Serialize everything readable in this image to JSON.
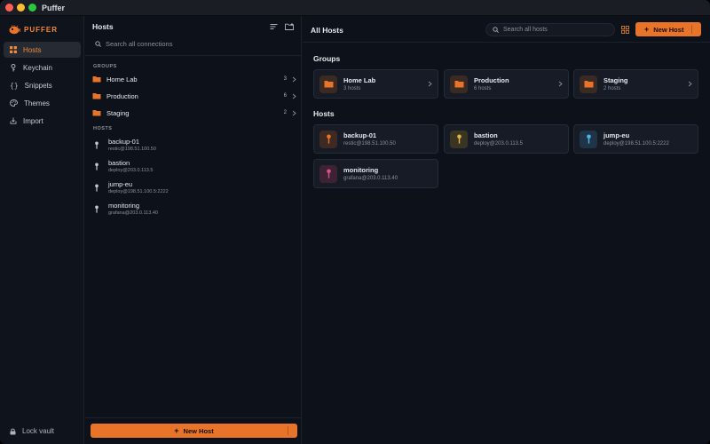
{
  "app": {
    "title": "Puffer",
    "brand": "PUFFER"
  },
  "colors": {
    "accent": "#e8742a",
    "background": "#0d1119",
    "folder": "#e8742a",
    "host_orange": "#e8742a",
    "host_yellow": "#e3b341",
    "host_blue": "#4fb3e8",
    "host_pink": "#d9508c"
  },
  "sidebar": {
    "items": [
      {
        "label": "Hosts",
        "icon": "grid-icon",
        "active": true
      },
      {
        "label": "Keychain",
        "icon": "key-icon",
        "active": false
      },
      {
        "label": "Snippets",
        "icon": "braces-icon",
        "active": false
      },
      {
        "label": "Themes",
        "icon": "palette-icon",
        "active": false
      },
      {
        "label": "Import",
        "icon": "import-icon",
        "active": false
      }
    ],
    "lock_label": "Lock vault"
  },
  "panel": {
    "title": "Hosts",
    "search_placeholder": "Search all connections",
    "groups_label": "GROUPS",
    "hosts_label": "HOSTS",
    "groups": [
      {
        "name": "Home Lab",
        "count": "3"
      },
      {
        "name": "Production",
        "count": "6"
      },
      {
        "name": "Staging",
        "count": "2"
      }
    ],
    "hosts": [
      {
        "name": "backup-01",
        "address": "restic@198.51.100.50"
      },
      {
        "name": "bastion",
        "address": "deploy@203.0.113.5"
      },
      {
        "name": "jump-eu",
        "address": "deploy@198.51.100.5:2222"
      },
      {
        "name": "monitoring",
        "address": "grafana@203.0.113.40"
      }
    ],
    "new_host_label": "New Host"
  },
  "main": {
    "title": "All Hosts",
    "search_placeholder": "Search all hosts",
    "new_host_label": "New Host",
    "groups_heading": "Groups",
    "hosts_heading": "Hosts",
    "group_cards": [
      {
        "name": "Home Lab",
        "sub": "3 hosts"
      },
      {
        "name": "Production",
        "sub": "6 hosts"
      },
      {
        "name": "Staging",
        "sub": "2 hosts"
      }
    ],
    "host_cards": [
      {
        "name": "backup-01",
        "sub": "restic@198.51.100.50",
        "color": "#e8742a"
      },
      {
        "name": "bastion",
        "sub": "deploy@203.0.113.5",
        "color": "#e3b341"
      },
      {
        "name": "jump-eu",
        "sub": "deploy@198.51.100.5:2222",
        "color": "#4fb3e8"
      },
      {
        "name": "monitoring",
        "sub": "grafana@203.0.113.40",
        "color": "#d9508c"
      }
    ]
  }
}
